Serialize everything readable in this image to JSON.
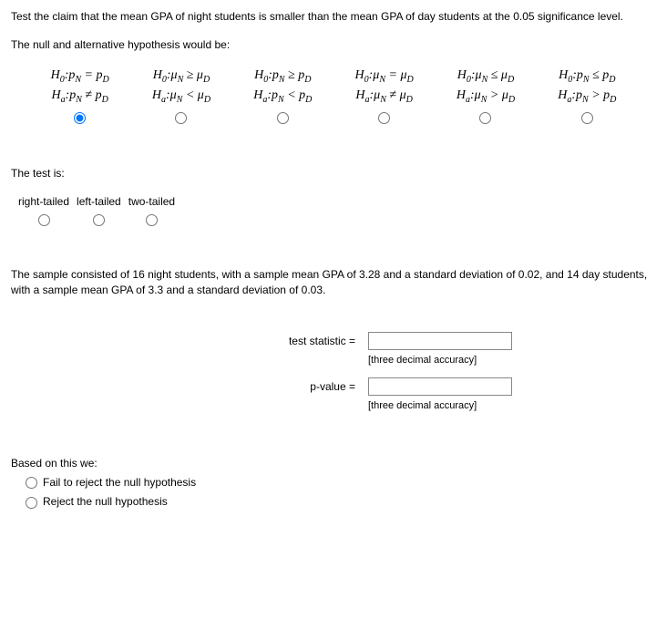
{
  "intro": "Test the claim that the mean GPA of night students is smaller than the mean GPA of day students at the 0.05 significance level.",
  "hyp_intro": "The null and alternative hypothesis would be:",
  "hypotheses": [
    {
      "h0": "H₀: pₙ = p_D",
      "ha": "Hₐ: pₙ ≠ p_D"
    },
    {
      "h0": "H₀: μₙ ≥ μ_D",
      "ha": "Hₐ: μₙ < μ_D"
    },
    {
      "h0": "H₀: pₙ ≥ p_D",
      "ha": "Hₐ: pₙ < p_D"
    },
    {
      "h0": "H₀: μₙ = μ_D",
      "ha": "Hₐ: μₙ ≠ μ_D"
    },
    {
      "h0": "H₀: μₙ ≤ μ_D",
      "ha": "Hₐ: μₙ > μ_D"
    },
    {
      "h0": "H₀: pₙ ≤ p_D",
      "ha": "Hₐ: pₙ > p_D"
    }
  ],
  "test_is": "The test is:",
  "tails": {
    "right": "right-tailed",
    "left": "left-tailed",
    "two": "two-tailed"
  },
  "sample_text": "The sample consisted of 16 night students, with a sample mean GPA of 3.28 and a standard deviation of 0.02, and 14 day students, with a sample mean GPA of 3.3 and a standard deviation of 0.03.",
  "calc": {
    "ts_label": "test statistic =",
    "pv_label": "p-value =",
    "hint": "[three decimal accuracy]"
  },
  "conclusion": {
    "intro": "Based on this we:",
    "fail": "Fail to reject the null hypothesis",
    "reject": "Reject the null hypothesis"
  }
}
